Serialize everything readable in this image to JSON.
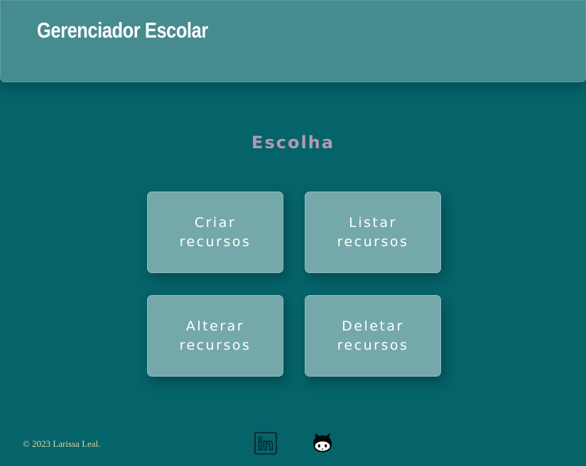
{
  "header": {
    "title": "Gerenciador Escolar"
  },
  "main": {
    "heading": "Escolha",
    "actions": [
      {
        "line1": "Criar",
        "line2": "recursos"
      },
      {
        "line1": "Listar",
        "line2": "recursos"
      },
      {
        "line1": "Alterar",
        "line2": "recursos"
      },
      {
        "line1": "Deletar",
        "line2": "recursos"
      }
    ]
  },
  "footer": {
    "copyright": "© 2023 Larissa Leal.",
    "icons": [
      "linkedin-icon",
      "github-icon"
    ]
  },
  "colors": {
    "background": "#05636a",
    "header": "#468c8f",
    "button": "#75a8ab",
    "heading": "#b39ab3",
    "footer_text": "#d6d6a0"
  }
}
